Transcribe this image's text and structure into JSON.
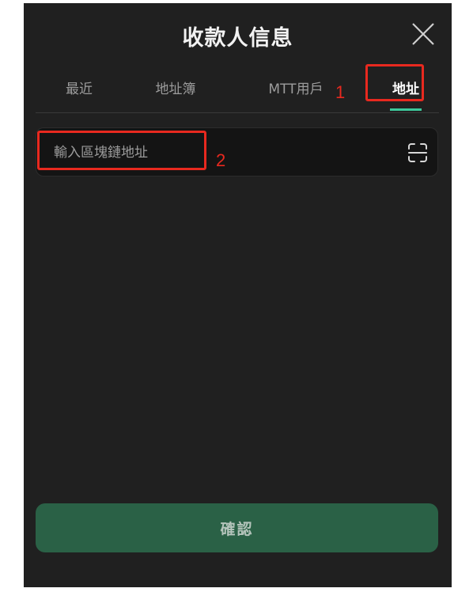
{
  "header": {
    "title": "收款人信息",
    "close_icon": "close-icon"
  },
  "tabs": [
    {
      "label": "最近",
      "active": false
    },
    {
      "label": "地址簿",
      "active": false
    },
    {
      "label": "MTT用戶",
      "active": false
    },
    {
      "label": "地址",
      "active": true
    }
  ],
  "annotations": {
    "marker_1": "1",
    "marker_2": "2",
    "highlight_color": "#e8291f"
  },
  "address_input": {
    "placeholder": "輸入區塊鏈地址",
    "value": "",
    "scan_icon": "scan-icon"
  },
  "footer": {
    "confirm_label": "確認"
  },
  "colors": {
    "background": "#202020",
    "accent": "#3cc89a",
    "button": "#2a6146"
  }
}
